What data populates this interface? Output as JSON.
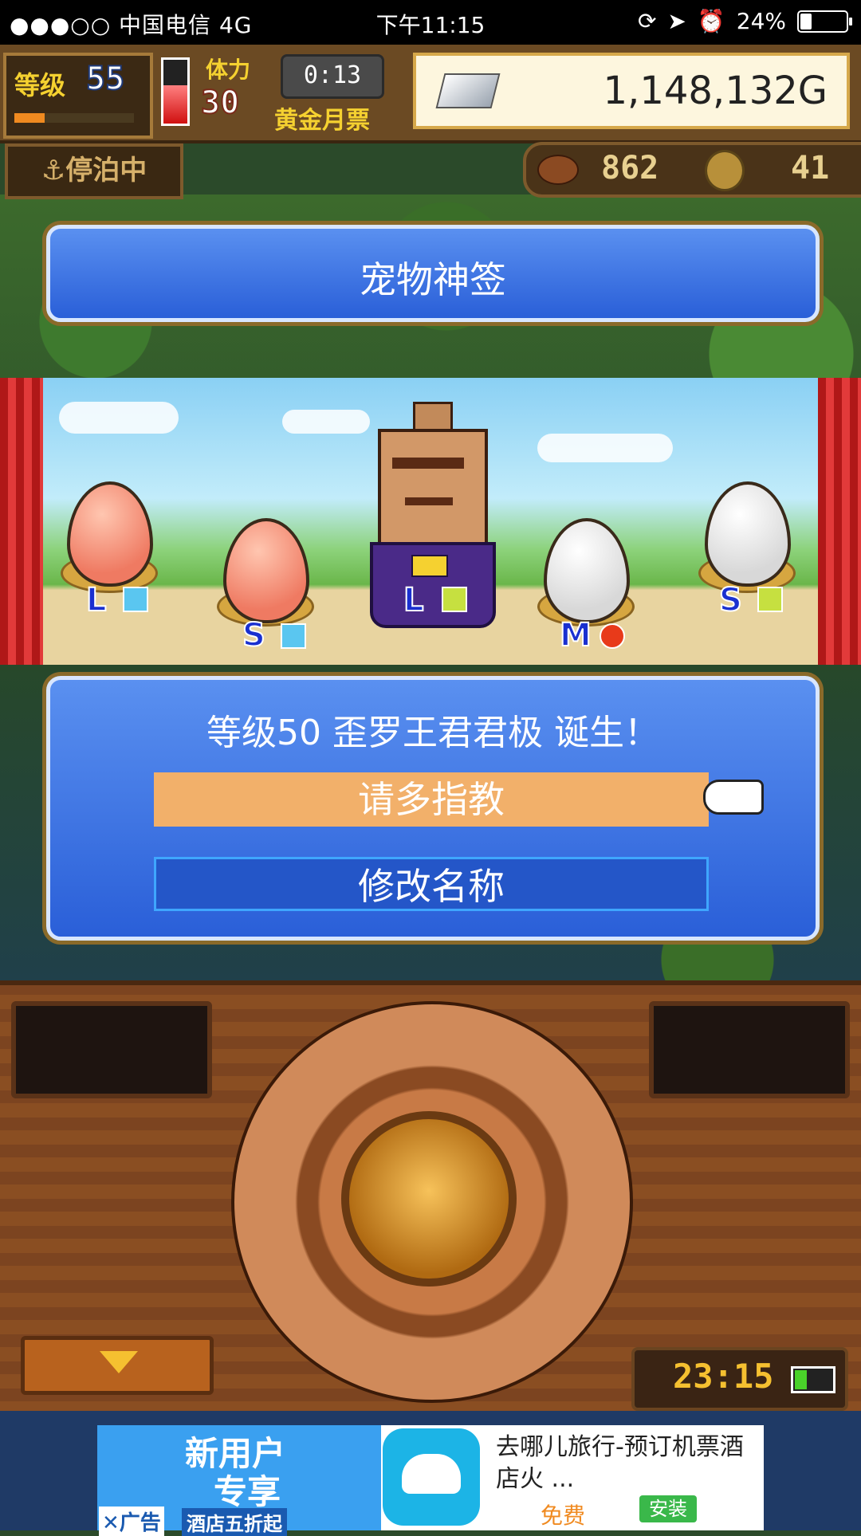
{
  "status_bar": {
    "signal": "●●●○○ 中国电信  4G",
    "time": "下午11:15",
    "battery": "24%",
    "battery_level": 0.24
  },
  "hud": {
    "level_label": "等级",
    "level_value": "55",
    "level_progress": 0.25,
    "stamina_label": "体力",
    "stamina_value": "30",
    "stamina_level": 0.6,
    "timer": "0:13",
    "pass_label": "黄金月票",
    "gold": "1,148,132G",
    "dock_status": "停泊中",
    "meat": "862",
    "medals": "41"
  },
  "title_panel": {
    "title": "宠物神签"
  },
  "scene": {
    "eggs": [
      {
        "label": "L",
        "color": "pink",
        "element": "ice"
      },
      {
        "label": "S",
        "color": "pink",
        "element": "ice"
      },
      {
        "label": "L",
        "color": "creature",
        "element": "wind"
      },
      {
        "label": "M",
        "color": "white",
        "element": "fire"
      },
      {
        "label": "S",
        "color": "white",
        "element": "wind"
      }
    ]
  },
  "dialog": {
    "message": "等级50 歪罗王君君极 诞生！",
    "ok_label": "请多指教",
    "rename_label": "修改名称"
  },
  "console": {
    "clock": "23:15",
    "battery_level": 0.3
  },
  "ad": {
    "promo_line1": "新用户",
    "promo_line2": "专享",
    "promo_line3": "酒店五折起",
    "ad_tag": "✕广告",
    "title": "去哪儿旅行-预订机票酒店火 ...",
    "price": "免费",
    "install_label": "安装"
  },
  "colors": {
    "panel_blue": "#2a5fd8",
    "ok_orange": "#f2b06a",
    "gold_text": "#f5d130"
  }
}
